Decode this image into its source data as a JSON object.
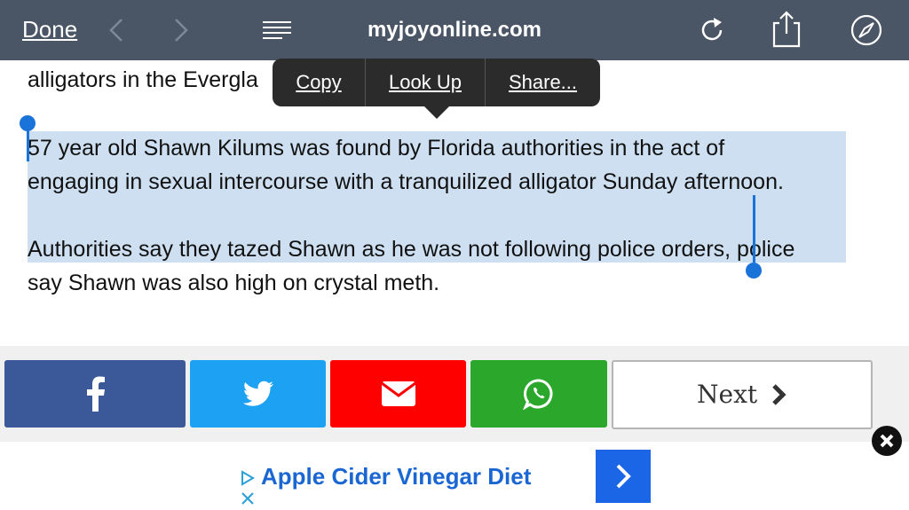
{
  "browser": {
    "done_label": "Done",
    "url": "myjoyonline.com",
    "bar_color": "#4a5566"
  },
  "article": {
    "line1": "alligators in the Evergla",
    "line2": "57 year old Shawn Kilums was found by Florida authorities in the act of",
    "line3": "engaging in sexual intercourse with a tranquilized alligator Sunday afternoon.",
    "line4": "Authorities say they tazed Shawn as he was not following police orders, police",
    "line5": "say Shawn was also high on crystal meth.",
    "selection_color": "#cddff0"
  },
  "context_menu": {
    "copy": "Copy",
    "look_up": "Look Up",
    "share": "Share..."
  },
  "share_bar": {
    "facebook_color": "#3b5998",
    "twitter_color": "#1da1f2",
    "email_color": "#ff0000",
    "whatsapp_color": "#2ba82b",
    "next_label": "Next"
  },
  "ad": {
    "text": "Apple Cider Vinegar Diet",
    "accent": "#1a66e6"
  }
}
